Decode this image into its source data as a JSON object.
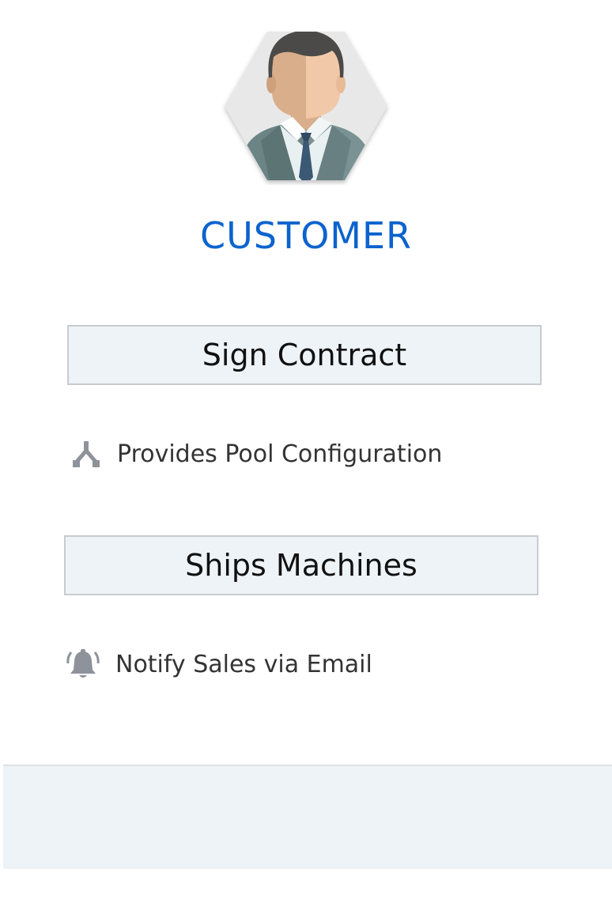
{
  "role": {
    "title": "CUSTOMER",
    "avatar_icon": "businessman-avatar-icon",
    "title_color": "#0b63ce"
  },
  "steps": [
    {
      "label": "Sign Contract"
    },
    {
      "label": "Ships Machines"
    }
  ],
  "tasks": [
    {
      "icon": "fork-icon",
      "label": "Provides Pool Configuration"
    },
    {
      "icon": "bell-icon",
      "label": "Notify Sales via Email"
    }
  ],
  "colors": {
    "box_fill": "#eef3f8",
    "box_border": "#c8cbd0",
    "icon": "#8e939b"
  }
}
